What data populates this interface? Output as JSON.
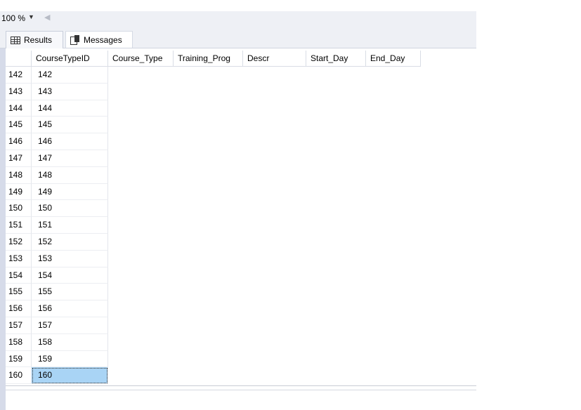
{
  "toolbar": {
    "zoom": "100 %"
  },
  "tabs": [
    {
      "label": "Results"
    },
    {
      "label": "Messages"
    }
  ],
  "grid": {
    "columns": [
      "CourseTypeID",
      "Course_Type",
      "Training_Prog",
      "Descr",
      "Start_Day",
      "End_Day"
    ],
    "rows": [
      {
        "num": "142",
        "id": "142"
      },
      {
        "num": "143",
        "id": "143"
      },
      {
        "num": "144",
        "id": "144"
      },
      {
        "num": "145",
        "id": "145"
      },
      {
        "num": "146",
        "id": "146"
      },
      {
        "num": "147",
        "id": "147"
      },
      {
        "num": "148",
        "id": "148"
      },
      {
        "num": "149",
        "id": "149"
      },
      {
        "num": "150",
        "id": "150"
      },
      {
        "num": "151",
        "id": "151"
      },
      {
        "num": "152",
        "id": "152"
      },
      {
        "num": "153",
        "id": "153"
      },
      {
        "num": "154",
        "id": "154"
      },
      {
        "num": "155",
        "id": "155"
      },
      {
        "num": "156",
        "id": "156"
      },
      {
        "num": "157",
        "id": "157"
      },
      {
        "num": "158",
        "id": "158"
      },
      {
        "num": "159",
        "id": "159"
      },
      {
        "num": "160",
        "id": "160"
      }
    ]
  }
}
